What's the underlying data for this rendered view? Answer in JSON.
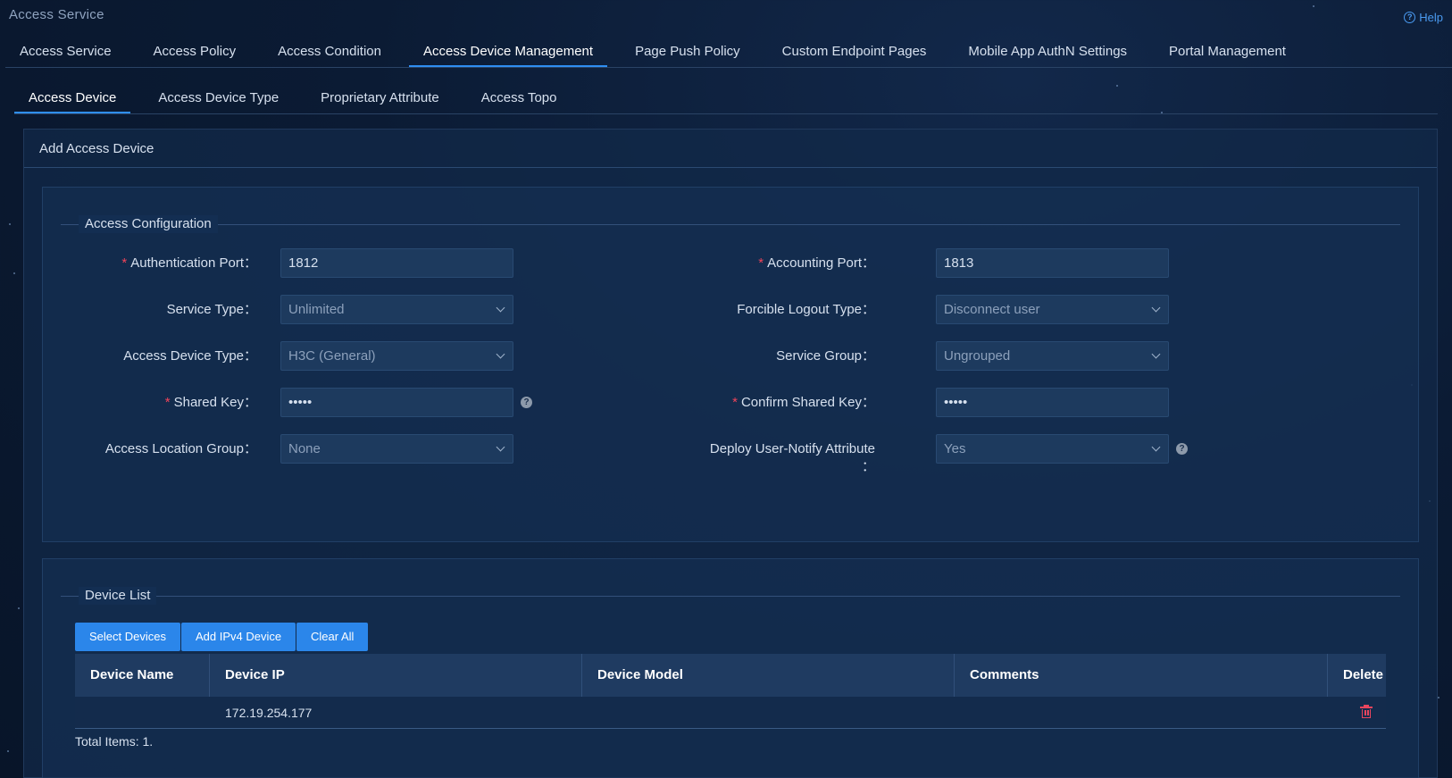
{
  "app": {
    "title": "Access Service",
    "help_label": "Help"
  },
  "main_tabs": [
    {
      "label": "Access Service"
    },
    {
      "label": "Access Policy"
    },
    {
      "label": "Access Condition"
    },
    {
      "label": "Access Device Management",
      "active": true
    },
    {
      "label": "Page Push Policy"
    },
    {
      "label": "Custom Endpoint Pages"
    },
    {
      "label": "Mobile App AuthN Settings"
    },
    {
      "label": "Portal Management"
    }
  ],
  "sub_tabs": [
    {
      "label": "Access Device",
      "active": true
    },
    {
      "label": "Access Device Type"
    },
    {
      "label": "Proprietary Attribute"
    },
    {
      "label": "Access Topo"
    }
  ],
  "panel": {
    "title": "Add Access Device"
  },
  "access_config": {
    "title": "Access Configuration",
    "authentication_port": {
      "label": "Authentication Port：",
      "value": "1812"
    },
    "accounting_port": {
      "label": "Accounting Port：",
      "value": "1813"
    },
    "service_type": {
      "label": "Service Type：",
      "value": "Unlimited"
    },
    "forcible_logout_type": {
      "label": "Forcible Logout Type：",
      "value": "Disconnect user"
    },
    "access_device_type": {
      "label": "Access Device Type：",
      "value": "H3C (General)"
    },
    "service_group": {
      "label": "Service Group：",
      "value": "Ungrouped"
    },
    "shared_key": {
      "label": "Shared Key：",
      "value": "•••••"
    },
    "confirm_shared_key": {
      "label": "Confirm Shared Key：",
      "value": "•••••"
    },
    "access_location_group": {
      "label": "Access Location Group：",
      "value": "None"
    },
    "deploy_user_notify": {
      "label": "Deploy User-Notify Attribute",
      "label_suffix": "：",
      "value": "Yes"
    }
  },
  "device_list": {
    "title": "Device List",
    "buttons": {
      "select": "Select Devices",
      "add_ipv4": "Add IPv4 Device",
      "clear_all": "Clear All"
    },
    "columns": [
      "Device Name",
      "Device IP",
      "Device Model",
      "Comments",
      "Delete"
    ],
    "rows": [
      {
        "name": "",
        "ip": "172.19.254.177",
        "model": "",
        "comments": ""
      }
    ],
    "total": "Total Items: 1."
  },
  "colors": {
    "accent": "#2f8ef2",
    "button": "#2b86ea",
    "required": "#f0445a",
    "delete": "#e8455e"
  }
}
